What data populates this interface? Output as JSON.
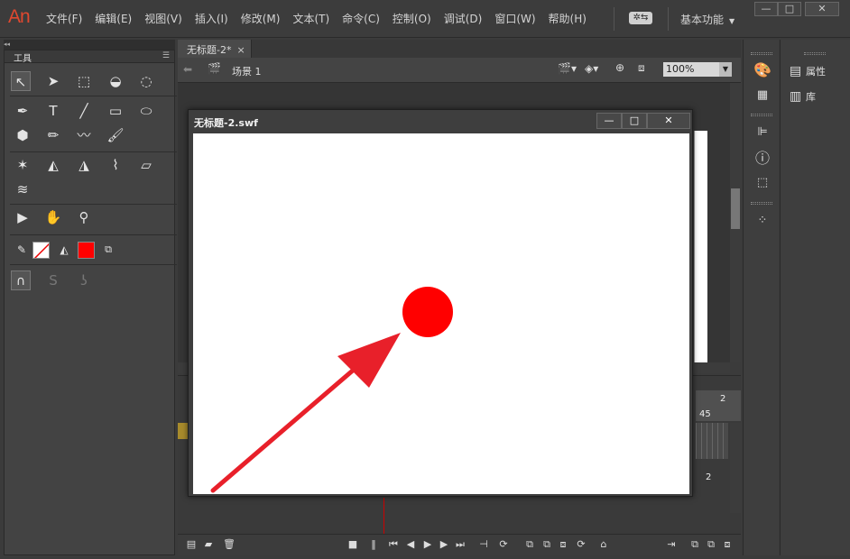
{
  "app": {
    "logo": "An"
  },
  "menu": [
    "文件(F)",
    "编辑(E)",
    "视图(V)",
    "插入(I)",
    "修改(M)",
    "文本(T)",
    "命令(C)",
    "控制(O)",
    "调试(D)",
    "窗口(W)",
    "帮助(H)"
  ],
  "workspace": {
    "label": "基本功能"
  },
  "window_controls": {
    "minimize": "—",
    "maximize": "□",
    "close": "✕"
  },
  "tools": {
    "title": "工具"
  },
  "document": {
    "tab_label": "无标题-2*",
    "tab_close": "×",
    "scene_label": "场景 1",
    "zoom": "100%"
  },
  "right_panel": {
    "properties_label": "属性",
    "library_label": "库"
  },
  "swf_window": {
    "title": "无标题-2.swf",
    "minimize": "—",
    "maximize": "□",
    "close": "✕"
  },
  "timeline": {
    "frame_label_a": "2",
    "frame_label_b": "45",
    "frame_label_c": "2"
  },
  "colors": {
    "ball": "#ff0000",
    "arrow": "#e8202a",
    "fill_swatch": "#ff0000",
    "logo": "#e0482f"
  }
}
